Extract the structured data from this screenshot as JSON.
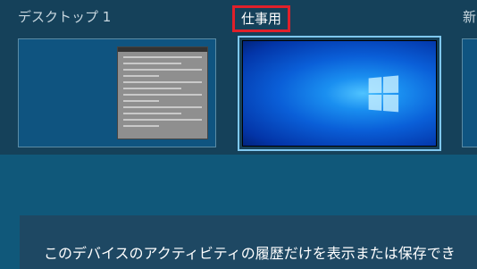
{
  "desktops": [
    {
      "label": "デスクトップ 1",
      "active": false
    },
    {
      "label": "仕事用",
      "active": true
    },
    {
      "label": "新",
      "active": false
    }
  ],
  "highlight_color": "#e0202a",
  "wallpaper": "windows-10-hero",
  "activity_notice": "このデバイスのアクティビティの履歴だけを表示または保存でき"
}
